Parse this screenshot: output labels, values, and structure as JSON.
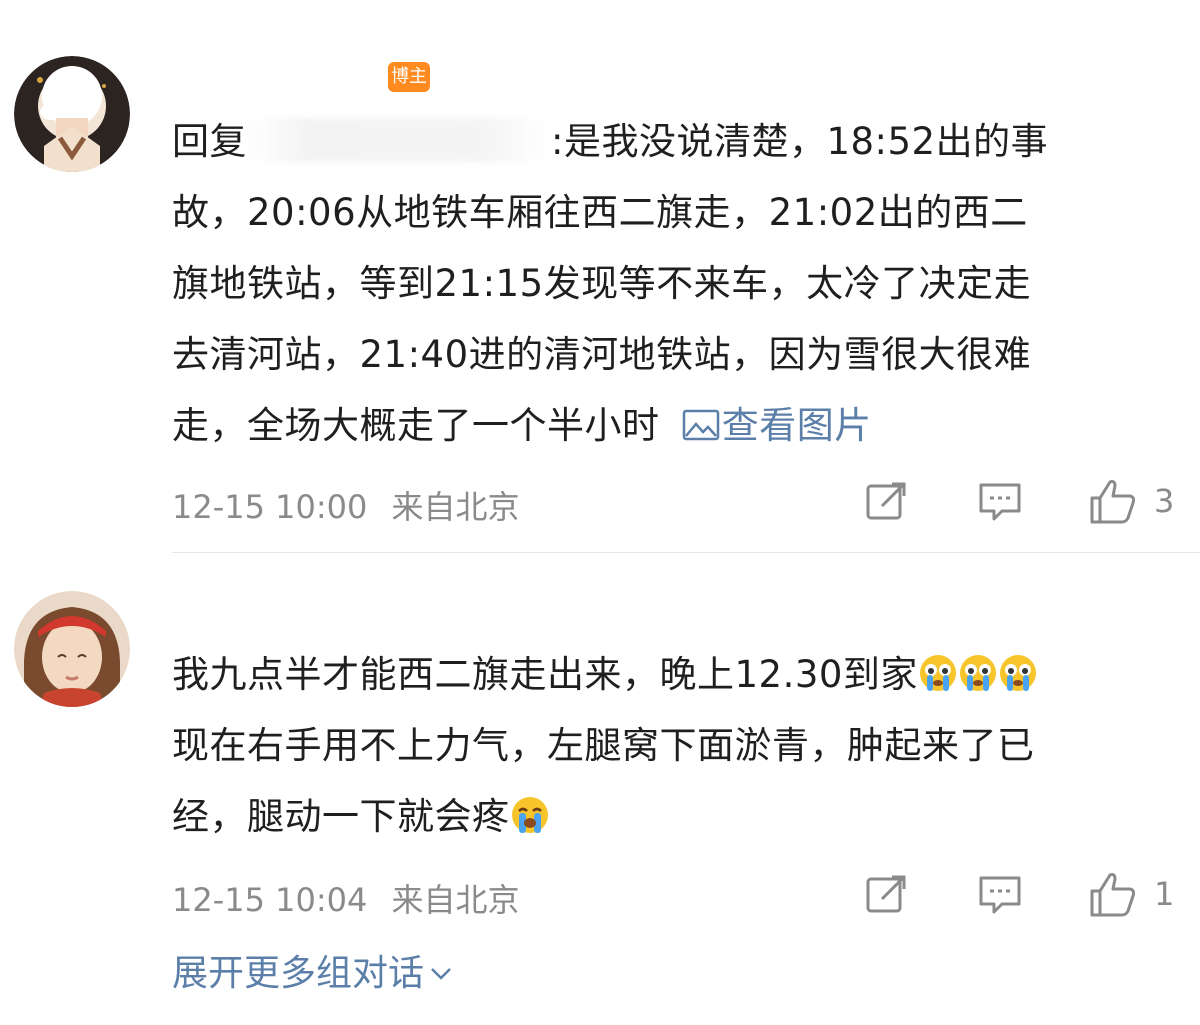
{
  "comments": [
    {
      "author_badge": "博主",
      "reply_prefix": "回复",
      "text_lines": [
        ":是我没说清楚，18:52出的事",
        "故，20:06从地铁车厢往西二旗走，21:02出的西二",
        "旗地铁站，等到21:15发现等不来车，太冷了决定走",
        "去清河站，21:40进的清河地铁站，因为雪很大很难",
        "走，全场大概走了一个半小时"
      ],
      "view_image_label": "查看图片",
      "time": "12-15 10:00",
      "location": "来自北京",
      "likes": "3"
    },
    {
      "text_lines": [
        "我九点半才能西二旗走出来，晚上12.30到家",
        "现在右手用不上力气，左腿窝下面淤青，肿起来了已",
        "经，腿动一下就会疼"
      ],
      "time": "12-15 10:04",
      "location": "来自北京",
      "likes": "1"
    }
  ],
  "more_replies_label": "展开更多组对话",
  "icons": [
    "picture-icon",
    "repost-icon",
    "comment-icon",
    "like-icon",
    "chevron-down-icon",
    "crying-emoji-icon"
  ],
  "colors": {
    "link": "#5b7fa8",
    "badge": "#ff8a1f",
    "meta": "#8a8a8a"
  }
}
